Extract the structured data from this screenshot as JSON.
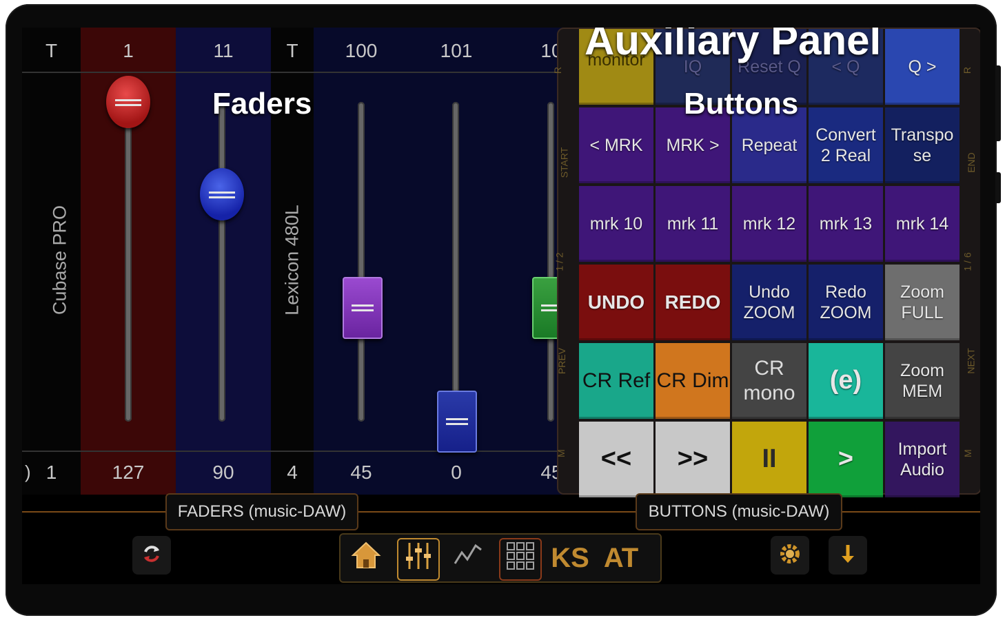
{
  "faders": {
    "overlay_title": "Faders",
    "strips": [
      {
        "label": "T",
        "value": "1"
      },
      {
        "label": "1",
        "value": "127"
      },
      {
        "label": "11",
        "value": "90"
      },
      {
        "label": "T",
        "value": "4"
      },
      {
        "label": "100",
        "value": "45"
      },
      {
        "label": "101",
        "value": "0"
      },
      {
        "label": "10",
        "value": "45"
      }
    ],
    "track_names": [
      "Cubase PRO",
      "Lexicon 480L"
    ],
    "left_edge_glyph": ")"
  },
  "aux_panel": {
    "title": "Auxiliary Panel",
    "overlay_buttons": "Buttons",
    "side_left": [
      "R",
      "START",
      "1 / 2",
      "PREV",
      "M"
    ],
    "side_right": [
      "R",
      "END",
      "1 / 6",
      "NEXT",
      "M"
    ],
    "buttons": [
      {
        "label": "monitor",
        "color": "#a08a14"
      },
      {
        "label": "IQ",
        "color": "#1f2a57"
      },
      {
        "label": "Reset Q",
        "color": "#1a2050"
      },
      {
        "label": "< Q",
        "color": "#1d2a60"
      },
      {
        "label": "Q >",
        "color": "#2a47b0"
      },
      {
        "label": "< MRK",
        "color": "#3f1678"
      },
      {
        "label": "MRK >",
        "color": "#3f1678"
      },
      {
        "label": "Repeat",
        "color": "#2a2a8a"
      },
      {
        "label": "Convert 2 Real",
        "color": "#1a2a80"
      },
      {
        "label": "Transpo se",
        "color": "#13205f"
      },
      {
        "label": "mrk 10",
        "color": "#3f1678"
      },
      {
        "label": "mrk 11",
        "color": "#3f1678"
      },
      {
        "label": "mrk 12",
        "color": "#3f1678"
      },
      {
        "label": "mrk 13",
        "color": "#3f1678"
      },
      {
        "label": "mrk 14",
        "color": "#3f1678"
      },
      {
        "label": "UNDO",
        "color": "#7a0e0e"
      },
      {
        "label": "REDO",
        "color": "#7a0e0e"
      },
      {
        "label": "Undo ZOOM",
        "color": "#15206a"
      },
      {
        "label": "Redo ZOOM",
        "color": "#15206a"
      },
      {
        "label": "Zoom FULL",
        "color": "#6e6e6e"
      },
      {
        "label": "CR Ref",
        "color": "#19a78a"
      },
      {
        "label": "CR Dim",
        "color": "#d0761e"
      },
      {
        "label": "CR mono",
        "color": "#444444"
      },
      {
        "label": "(e)",
        "color": "#19b69a"
      },
      {
        "label": "Zoom MEM",
        "color": "#444444"
      },
      {
        "label": "<<",
        "color": "#c8c8c8"
      },
      {
        "label": ">>",
        "color": "#c8c8c8"
      },
      {
        "label": "II",
        "color": "#c2a60c"
      },
      {
        "label": ">",
        "color": "#10a03a"
      },
      {
        "label": "Import Audio",
        "color": "#33165e"
      }
    ]
  },
  "tabs": {
    "faders": "FADERS (music-DAW)",
    "buttons": "BUTTONS (music-DAW)"
  },
  "toolbar": {
    "ks_label": "KS",
    "at_label": "AT",
    "icons": [
      "home-icon",
      "mixer-icon",
      "automation-icon",
      "grid-icon"
    ]
  },
  "nav": {
    "back": "◁",
    "home": "○",
    "recent": "□"
  }
}
